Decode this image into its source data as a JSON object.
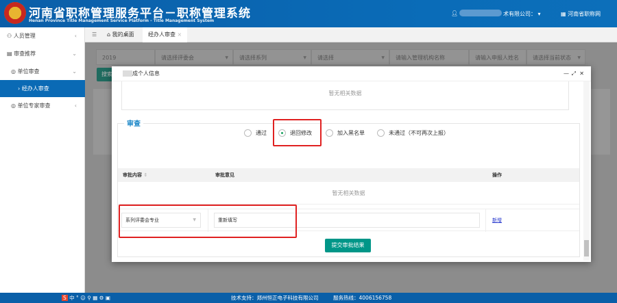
{
  "header": {
    "title": "河南省职称管理服务平台－职称管理系统",
    "subtitle": "Henan Province Title Management Service Platform - Title Management System",
    "user_company": "术有限公司：",
    "site_link": "河南省职称网",
    "colors": {
      "header": "#0a5fa8",
      "active": "#0a6ab5",
      "button": "#009688"
    }
  },
  "sidebar": {
    "items": [
      {
        "label": "人员管理",
        "icon": "user-icon"
      },
      {
        "label": "审查推荐",
        "icon": "document-icon"
      },
      {
        "label": "单位审查",
        "icon": "circle-icon"
      },
      {
        "label": "经办人审查",
        "active": true
      },
      {
        "label": "单位专家审查",
        "icon": "circle-icon"
      }
    ]
  },
  "tabs": [
    {
      "label": "我的桌面",
      "icon": "home-icon"
    },
    {
      "label": "经办人审查",
      "active": true
    }
  ],
  "filters": {
    "year": "2019",
    "committee": "请选择评委会",
    "series": "请选择系列",
    "select": "请选择",
    "org_placeholder": "请输入管理机构名称",
    "name_placeholder": "请输入申报人姓名",
    "status": "请选择当前状态",
    "search_button": "搜索"
  },
  "dialog": {
    "title": "成个人信息",
    "top_empty": "暂无相关数据",
    "section_title": "审查",
    "radios": [
      {
        "label": "通过",
        "checked": false
      },
      {
        "label": "退回修改",
        "checked": true
      },
      {
        "label": "加入黑名单",
        "checked": false
      },
      {
        "label": "未通过（不可再次上报）",
        "checked": false
      }
    ],
    "table": {
      "headers": [
        "审批内容",
        "审批意见",
        "操作"
      ],
      "empty": "暂无相关数据",
      "row": {
        "content": "系列评委会专业",
        "opinion": "重新填写",
        "action": "新增"
      }
    },
    "submit": "提交审批结果"
  },
  "footer": {
    "support": "技术支持：郑州恒正电子科技有限公司",
    "hotline": "服务热线：4006156758"
  }
}
